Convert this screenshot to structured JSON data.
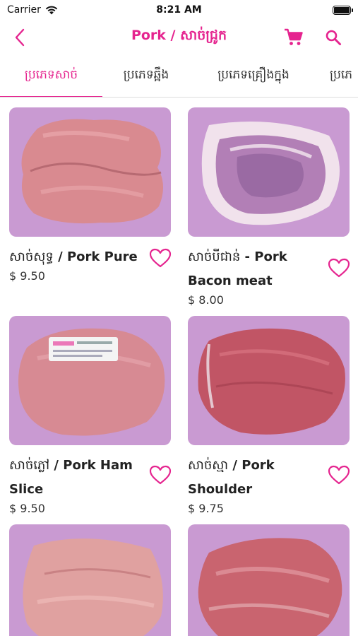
{
  "status_bar": {
    "carrier": "Carrier",
    "time": "8:21 AM"
  },
  "nav": {
    "title_en": "Pork",
    "title_sep": " / ",
    "title_km": "សាច់ជ្រូក",
    "accent_color": "#e5248f",
    "icons": [
      "chevron-left-icon",
      "cart-icon",
      "search-icon"
    ]
  },
  "tabs": [
    {
      "label": "ប្រភេទសាច់",
      "active": true
    },
    {
      "label": "ប្រភេទឆ្អឹង",
      "active": false
    },
    {
      "label": "ប្រភេទគ្រឿងក្នុង",
      "active": false
    },
    {
      "label": "ប្រភេ",
      "active": false
    }
  ],
  "products": [
    {
      "name_km": "សាច់សុទ្ធ",
      "name_sep": " / ",
      "name_en": "Pork Pure",
      "price": "$ 9.50"
    },
    {
      "name_km": "សាច់បីជាន់",
      "name_sep": " - ",
      "name_en": "Pork Bacon meat",
      "price": "$ 8.00"
    },
    {
      "name_km": "សាច់ភ្លៅ",
      "name_sep": " / ",
      "name_en": "Pork Ham Slice",
      "price": "$ 9.50"
    },
    {
      "name_km": "សាច់ស្មា",
      "name_sep": " / ",
      "name_en": "Pork Shoulder",
      "price": "$ 9.75"
    },
    {
      "name_km": "",
      "name_sep": "",
      "name_en": "",
      "price": ""
    },
    {
      "name_km": "",
      "name_sep": "",
      "name_en": "",
      "price": ""
    }
  ],
  "image_background_color": "#c99ad2"
}
